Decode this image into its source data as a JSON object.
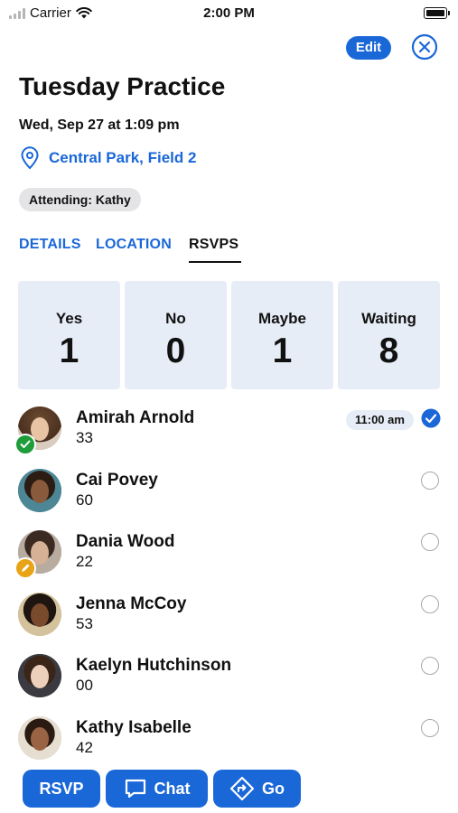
{
  "status_bar": {
    "carrier": "Carrier",
    "time": "2:00 PM"
  },
  "header": {
    "edit_label": "Edit",
    "title": "Tuesday Practice",
    "date": "Wed, Sep 27 at 1:09 pm",
    "location": "Central Park, Field 2",
    "attending": "Attending: Kathy"
  },
  "tabs": [
    {
      "label": "DETAILS",
      "active": false
    },
    {
      "label": "LOCATION",
      "active": false
    },
    {
      "label": "RSVPS",
      "active": true
    }
  ],
  "stats": [
    {
      "label": "Yes",
      "value": "1"
    },
    {
      "label": "No",
      "value": "0"
    },
    {
      "label": "Maybe",
      "value": "1"
    },
    {
      "label": "Waiting",
      "value": "8"
    }
  ],
  "players": [
    {
      "name": "Amirah Arnold",
      "number": "33",
      "status": "yes",
      "time": "11:00 am"
    },
    {
      "name": "Cai Povey",
      "number": "60",
      "status": "waiting"
    },
    {
      "name": "Dania Wood",
      "number": "22",
      "status": "maybe"
    },
    {
      "name": "Jenna McCoy",
      "number": "53",
      "status": "waiting"
    },
    {
      "name": "Kaelyn Hutchinson",
      "number": "00",
      "status": "waiting"
    },
    {
      "name": "Kathy Isabelle",
      "number": "42",
      "status": "waiting"
    }
  ],
  "actions": {
    "rsvp_label": "RSVP",
    "chat_label": "Chat",
    "go_label": "Go"
  },
  "colors": {
    "accent": "#1a67d8",
    "yes": "#1f9d3a",
    "maybe": "#e8a317",
    "card_bg": "#e6edf6"
  }
}
